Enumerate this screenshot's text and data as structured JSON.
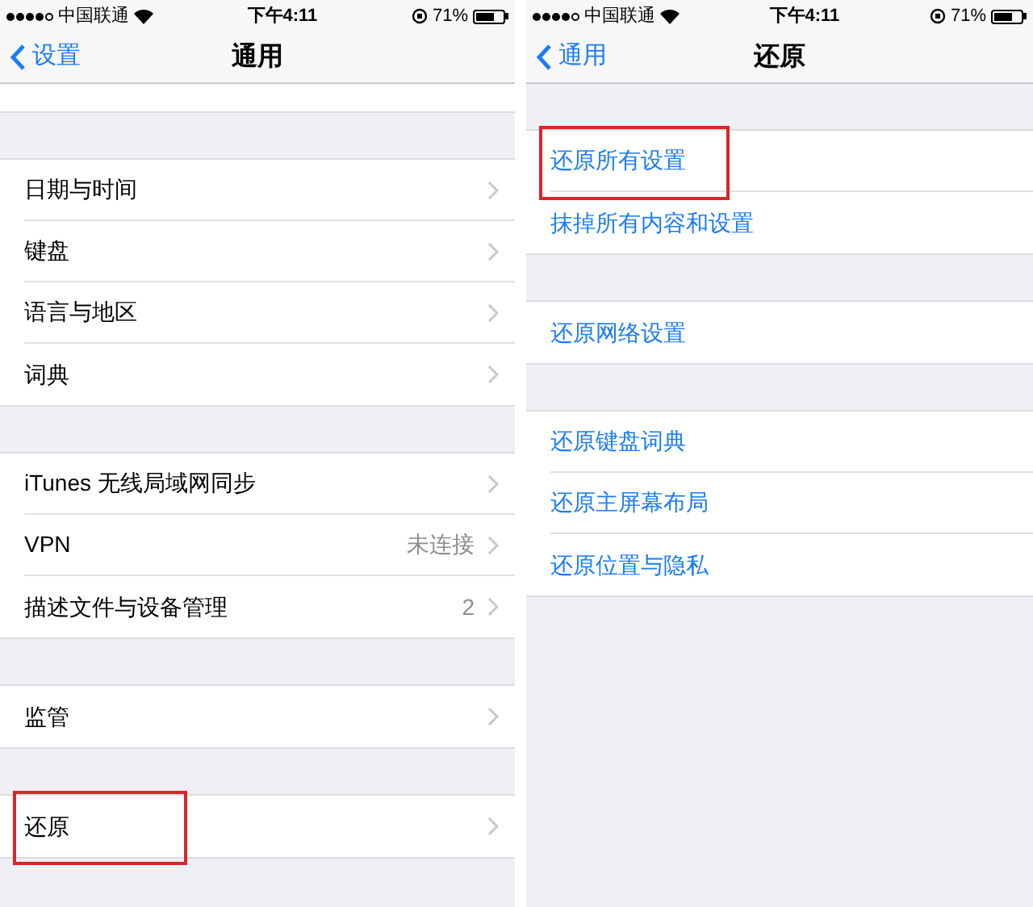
{
  "panels": [
    {
      "status_bar": {
        "carrier": "中国联通",
        "time": "下午4:11",
        "battery": "71%"
      },
      "nav": {
        "back": "设置",
        "title": "通用"
      },
      "scrolled": true,
      "kind": "settings",
      "groups": [
        {
          "rows": [
            {
              "label": "日期与时间",
              "highlighted": false
            },
            {
              "label": "键盘",
              "highlighted": false
            },
            {
              "label": "语言与地区",
              "highlighted": false
            },
            {
              "label": "词典",
              "highlighted": false
            }
          ]
        },
        {
          "rows": [
            {
              "label": "iTunes 无线局域网同步",
              "highlighted": false
            },
            {
              "label": "VPN",
              "value": "未连接",
              "highlighted": false
            },
            {
              "label": "描述文件与设备管理",
              "value": "2",
              "highlighted": false
            }
          ]
        },
        {
          "rows": [
            {
              "label": "监管",
              "highlighted": false
            }
          ]
        },
        {
          "rows": [
            {
              "label": "还原",
              "highlighted": true
            }
          ]
        }
      ]
    },
    {
      "status_bar": {
        "carrier": "中国联通",
        "time": "下午4:11",
        "battery": "71%"
      },
      "nav": {
        "back": "通用",
        "title": "还原"
      },
      "scrolled": false,
      "kind": "actions",
      "groups": [
        {
          "rows": [
            {
              "label": "还原所有设置",
              "highlighted": true
            },
            {
              "label": "抹掉所有内容和设置",
              "highlighted": false
            }
          ]
        },
        {
          "rows": [
            {
              "label": "还原网络设置",
              "highlighted": false
            }
          ]
        },
        {
          "rows": [
            {
              "label": "还原键盘词典",
              "highlighted": false
            },
            {
              "label": "还原主屏幕布局",
              "highlighted": false
            },
            {
              "label": "还原位置与隐私",
              "highlighted": false
            }
          ]
        }
      ]
    }
  ]
}
